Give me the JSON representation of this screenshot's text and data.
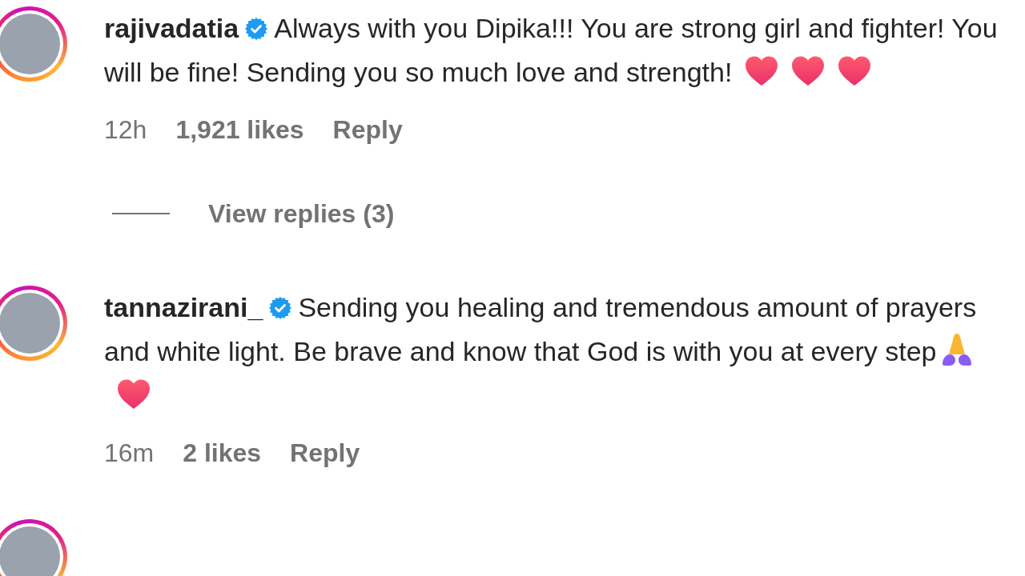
{
  "comments": [
    {
      "story_ring": true,
      "username": "rajivadatia",
      "verified": true,
      "text": "Always with you Dipika!!! You are strong girl and fighter! You will be fine! Sending you so much love and strength!",
      "emoji": [
        {
          "kind": "heart"
        },
        {
          "kind": "heart"
        },
        {
          "kind": "heart"
        }
      ],
      "time": "12h",
      "likes": "1,921 likes",
      "reply": "Reply",
      "view_replies": "View replies (3)"
    },
    {
      "story_ring": true,
      "username": "tannazirani_",
      "verified": true,
      "text": "Sending you healing and tremendous amount of prayers and white light. Be brave and know that God is with you at every step",
      "emoji": [
        {
          "kind": "folded_hands"
        },
        {
          "kind": "heart"
        }
      ],
      "time": "16m",
      "likes": "2 likes",
      "reply": "Reply"
    },
    {
      "story_ring": true
    }
  ]
}
